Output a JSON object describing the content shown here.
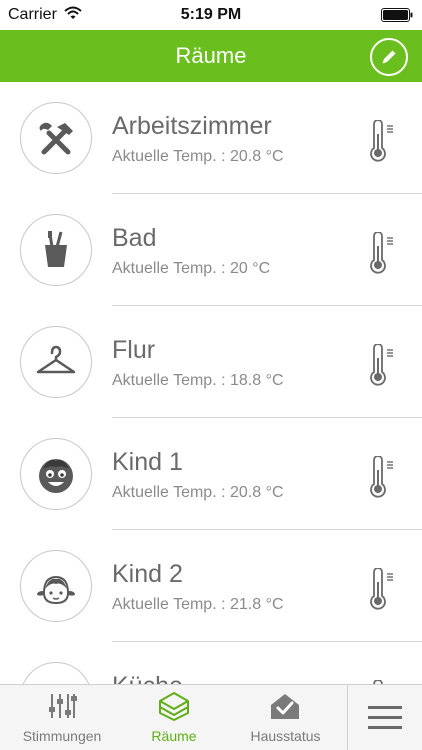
{
  "status_bar": {
    "carrier": "Carrier",
    "time": "5:19 PM"
  },
  "header": {
    "title": "Räume",
    "edit_icon": "pencil-icon"
  },
  "colors": {
    "accent": "#6abf1e",
    "active_tab": "#5fae16"
  },
  "rooms": [
    {
      "name": "Arbeitszimmer",
      "temp": "Aktuelle Temp. : 20.8 °C",
      "icon": "tools-icon"
    },
    {
      "name": "Bad",
      "temp": "Aktuelle Temp. : 20 °C",
      "icon": "toothbrush-cup-icon"
    },
    {
      "name": "Flur",
      "temp": "Aktuelle Temp. : 18.8 °C",
      "icon": "hanger-icon"
    },
    {
      "name": "Kind 1",
      "temp": "Aktuelle Temp. : 20.8 °C",
      "icon": "boy-face-icon"
    },
    {
      "name": "Kind 2",
      "temp": "Aktuelle Temp. : 21.8 °C",
      "icon": "girl-face-icon"
    },
    {
      "name": "Küche",
      "temp": "",
      "icon": "kitchen-icon"
    }
  ],
  "tabs": [
    {
      "label": "Stimmungen",
      "icon": "sliders-icon",
      "active": false
    },
    {
      "label": "Räume",
      "icon": "rooms-icon",
      "active": true
    },
    {
      "label": "Hausstatus",
      "icon": "house-check-icon",
      "active": false
    }
  ],
  "menu_icon": "hamburger-menu-icon"
}
